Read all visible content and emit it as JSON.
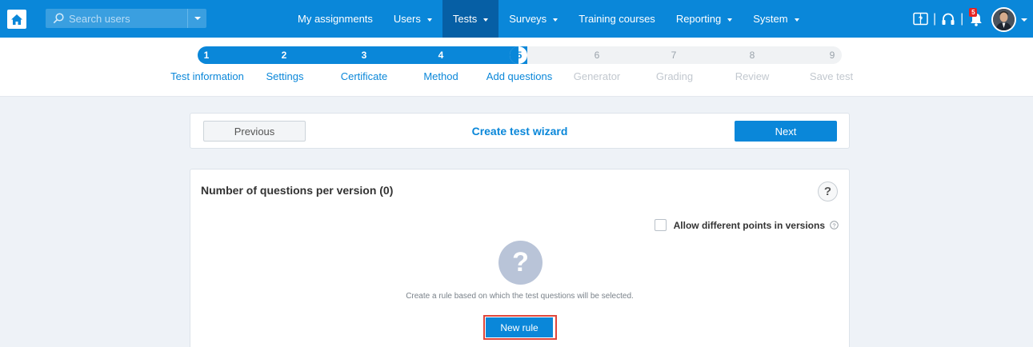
{
  "navbar": {
    "search_placeholder": "Search users",
    "menu": [
      {
        "label": "My assignments",
        "dropdown": false,
        "active": false
      },
      {
        "label": "Users",
        "dropdown": true,
        "active": false
      },
      {
        "label": "Tests",
        "dropdown": true,
        "active": true
      },
      {
        "label": "Surveys",
        "dropdown": true,
        "active": false
      },
      {
        "label": "Training courses",
        "dropdown": false,
        "active": false
      },
      {
        "label": "Reporting",
        "dropdown": true,
        "active": false
      },
      {
        "label": "System",
        "dropdown": true,
        "active": false
      }
    ],
    "notification_count": "5",
    "icons": [
      "home-icon",
      "search-icon",
      "manual-icon",
      "headset-icon",
      "bell-icon",
      "avatar"
    ]
  },
  "steps": [
    {
      "num": "1",
      "label": "Test information",
      "state": "done"
    },
    {
      "num": "2",
      "label": "Settings",
      "state": "done"
    },
    {
      "num": "3",
      "label": "Certificate",
      "state": "done"
    },
    {
      "num": "4",
      "label": "Method",
      "state": "done"
    },
    {
      "num": "5",
      "label": "Add questions",
      "state": "current"
    },
    {
      "num": "6",
      "label": "Generator",
      "state": "future"
    },
    {
      "num": "7",
      "label": "Grading",
      "state": "future"
    },
    {
      "num": "8",
      "label": "Review",
      "state": "future"
    },
    {
      "num": "9",
      "label": "Save test",
      "state": "future"
    }
  ],
  "wizard": {
    "previous_label": "Previous",
    "title": "Create test wizard",
    "next_label": "Next"
  },
  "card": {
    "title": "Number of questions per version (0)",
    "help_symbol": "?",
    "allow_label": "Allow different points in versions",
    "allow_checked": false,
    "empty_symbol": "?",
    "empty_text": "Create a rule based on which the test questions will be selected.",
    "new_rule_label": "New rule"
  },
  "colors": {
    "primary": "#0a87d9",
    "nav_active": "#065fa5",
    "highlight": "#e0463b",
    "badge": "#e62525"
  }
}
